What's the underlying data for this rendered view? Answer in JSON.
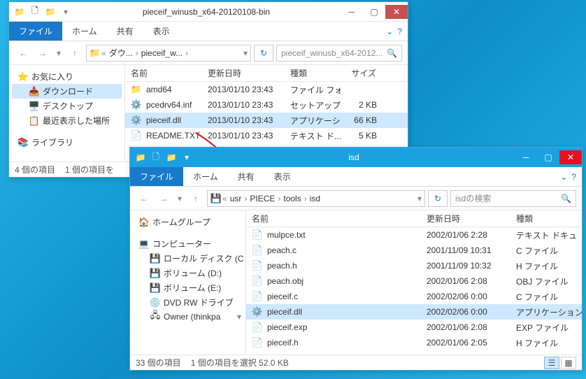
{
  "w1": {
    "title": "pieceif_winusb_x64-20120108-bin",
    "ribbon": {
      "file": "ファイル",
      "home": "ホーム",
      "share": "共有",
      "view": "表示"
    },
    "nav": {
      "path": [
        "ダウ...",
        "pieceif_w..."
      ],
      "search": "pieceif_winusb_x64-2012..."
    },
    "tree": {
      "fav": "お気に入り",
      "dl": "ダウンロード",
      "desk": "デスクトップ",
      "recent": "最近表示した場所",
      "lib": "ライブラリ"
    },
    "cols": {
      "name": "名前",
      "date": "更新日時",
      "type": "種類",
      "size": "サイズ"
    },
    "rows": [
      {
        "icon": "folder",
        "name": "amd64",
        "date": "2013/01/10 23:43",
        "type": "ファイル フォ...",
        "size": ""
      },
      {
        "icon": "inf",
        "name": "pcedrv64.inf",
        "date": "2013/01/10 23:43",
        "type": "セットアップ...",
        "size": "2 KB"
      },
      {
        "icon": "dll",
        "name": "pieceif.dll",
        "date": "2013/01/10 23:43",
        "type": "アプリケーシ...",
        "size": "66 KB",
        "sel": true
      },
      {
        "icon": "txt",
        "name": "README.TXT",
        "date": "2013/01/10 23:43",
        "type": "テキスト ド...",
        "size": "5 KB"
      }
    ],
    "status": {
      "count": "4 個の項目",
      "sel": "1 個の項目を"
    }
  },
  "w2": {
    "title": "isd",
    "ribbon": {
      "file": "ファイル",
      "home": "ホーム",
      "share": "共有",
      "view": "表示"
    },
    "nav": {
      "path": [
        "usr",
        "PIECE",
        "tools",
        "isd"
      ],
      "search": "isdの検索"
    },
    "tree": {
      "home": "ホームグループ",
      "comp": "コンピューター",
      "c": "ローカル ディスク (C",
      "d": "ボリューム (D:)",
      "e": "ボリューム (E:)",
      "dvd": "DVD RW ドライブ",
      "owner": "Owner (thinkpa"
    },
    "cols": {
      "name": "名前",
      "date": "更新日時",
      "type": "種類"
    },
    "rows": [
      {
        "icon": "txt",
        "name": "mulpce.txt",
        "date": "2002/01/06 2:28",
        "type": "テキスト ドキュ"
      },
      {
        "icon": "c",
        "name": "peach.c",
        "date": "2001/11/09 10:31",
        "type": "C ファイル"
      },
      {
        "icon": "h",
        "name": "peach.h",
        "date": "2001/11/09 10:32",
        "type": "H ファイル"
      },
      {
        "icon": "obj",
        "name": "peach.obj",
        "date": "2002/01/06 2:08",
        "type": "OBJ ファイル"
      },
      {
        "icon": "c",
        "name": "pieceif.c",
        "date": "2002/02/06 0:00",
        "type": "C ファイル"
      },
      {
        "icon": "dll",
        "name": "pieceif.dll",
        "date": "2002/02/06 0:00",
        "type": "アプリケーション",
        "sel": true
      },
      {
        "icon": "exp",
        "name": "pieceif.exp",
        "date": "2002/01/06 2:08",
        "type": "EXP ファイル"
      },
      {
        "icon": "h",
        "name": "pieceif.h",
        "date": "2002/01/06 2:05",
        "type": "H ファイル"
      }
    ],
    "status": {
      "count": "33 個の項目",
      "sel": "1 個の項目を選択 52.0 KB"
    }
  }
}
